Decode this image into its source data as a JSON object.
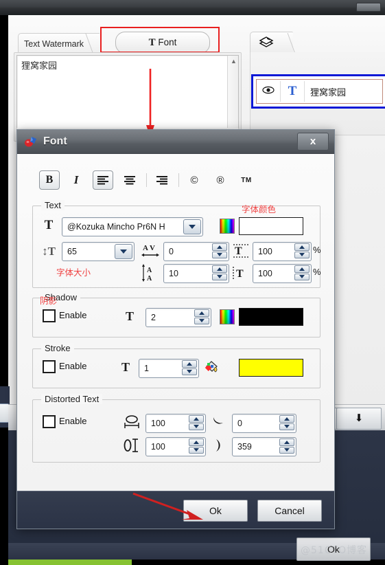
{
  "app": {
    "title_bar_present": true,
    "tabs": {
      "text_watermark": "Text Watermark",
      "font_tab_glyph": "T",
      "font_tab_label": "Font",
      "layers_tab_icon": "layers-icon"
    },
    "text_area": {
      "value": "狸窝家园",
      "vscroll_up": "▲",
      "vscroll_down": "▼",
      "hscroll_left": "◄",
      "hscroll_right": "►"
    },
    "layers_panel": {
      "row": {
        "eye_icon": "eye-icon",
        "type_glyph": "T",
        "label": "狸窝家园"
      }
    },
    "bottom_toolbar": {
      "down_button_glyph": "⬇"
    },
    "watermark": {
      "button_label": "Ok",
      "site_text": "@51CTO博客"
    }
  },
  "dialog": {
    "title": "Font",
    "icon": "font-app-icon",
    "close_label": "x",
    "toolbar": [
      {
        "name": "bold",
        "glyph": "B",
        "active": true
      },
      {
        "name": "italic",
        "glyph": "I",
        "active": false
      },
      {
        "name": "align-left",
        "glyph": "≡",
        "active": true
      },
      {
        "name": "align-center",
        "glyph": "≡",
        "active": false
      },
      {
        "name": "align-right",
        "glyph": "≡",
        "active": false
      },
      {
        "name": "copyright",
        "glyph": "©",
        "active": false
      },
      {
        "name": "registered",
        "glyph": "®",
        "active": false
      },
      {
        "name": "trademark",
        "glyph": "TM",
        "active": false
      }
    ],
    "text_group": {
      "legend": "Text",
      "font_family": "@Kozuka Mincho Pr6N H",
      "font_size": "65",
      "kerning": "0",
      "line_spacing": "10",
      "vertical_scale": "100",
      "horizontal_scale": "100",
      "percent_symbol": "%",
      "color_value": "#FFFFFF"
    },
    "shadow_group": {
      "legend": "Shadow",
      "enable_label": "Enable",
      "enabled": false,
      "size": "2",
      "color_value": "#000000"
    },
    "stroke_group": {
      "legend": "Stroke",
      "enable_label": "Enable",
      "enabled": false,
      "width": "1",
      "color_value": "#FFFF00"
    },
    "distorted_group": {
      "legend": "Distorted Text",
      "enable_label": "Enable",
      "enabled": false,
      "width_pct": "100",
      "height_pct": "100",
      "arc_start": "0",
      "arc_end": "359"
    },
    "footer": {
      "ok_label": "Ok",
      "cancel_label": "Cancel"
    }
  },
  "annotations": {
    "font_color": "字体颜色",
    "font_size": "字体大小",
    "shadow": "阴影",
    "accent_color": "#EF4242"
  }
}
